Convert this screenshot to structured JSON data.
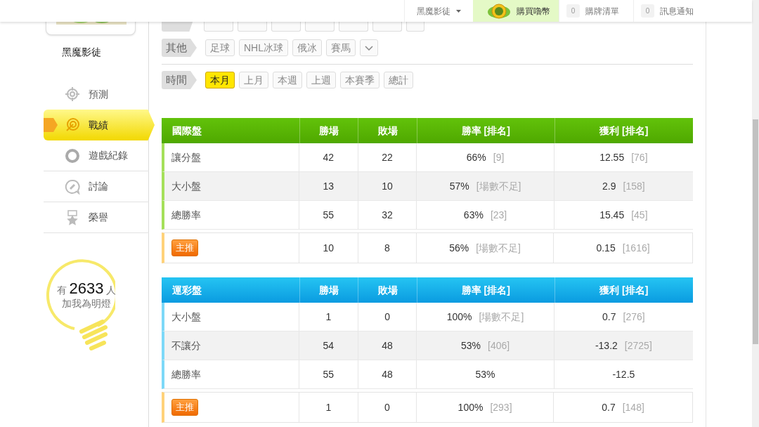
{
  "header": {
    "user_menu": "黑魔影徒",
    "buy_coins": "購買嚕幣",
    "cart": {
      "count": "0",
      "label": "購牌清單"
    },
    "notifications": {
      "count": "0",
      "label": "訊息通知"
    }
  },
  "profile": {
    "name": "黑魔影徒"
  },
  "nav": [
    {
      "label": "預測",
      "selected": false
    },
    {
      "label": "戰績",
      "selected": true
    },
    {
      "label": "遊戲紀錄",
      "selected": false
    },
    {
      "label": "討論",
      "selected": false
    },
    {
      "label": "榮譽",
      "selected": false
    }
  ],
  "fans": {
    "prefix": "有",
    "count": "2633",
    "suffix": "人",
    "caption": "加我為明燈"
  },
  "filters": [
    {
      "label": "其他",
      "options": [
        {
          "label": "足球",
          "selected": false
        },
        {
          "label": "NHL冰球",
          "selected": false
        },
        {
          "label": "俄冰",
          "selected": false
        },
        {
          "label": "賽馬",
          "selected": false
        }
      ],
      "more": true
    },
    {
      "label": "時間",
      "options": [
        {
          "label": "本月",
          "selected": true
        },
        {
          "label": "上月",
          "selected": false
        },
        {
          "label": "本週",
          "selected": false
        },
        {
          "label": "上週",
          "selected": false
        },
        {
          "label": "本賽季",
          "selected": false
        },
        {
          "label": "總計",
          "selected": false
        }
      ],
      "more": false
    }
  ],
  "tables": [
    {
      "kind": "international",
      "columns": [
        "國際盤",
        "勝場",
        "敗場",
        "勝率 [排名]",
        "獲利 [排名]"
      ],
      "rows": [
        {
          "kind": "normal",
          "name": "讓分盤",
          "wins": "42",
          "losses": "22",
          "rate": "66%",
          "rate_rank": "[9]",
          "profit": "12.55",
          "profit_rank": "[76]"
        },
        {
          "kind": "normal",
          "name": "大小盤",
          "wins": "13",
          "losses": "10",
          "rate": "57%",
          "rate_rank": "[場數不足]",
          "profit": "2.9",
          "profit_rank": "[158]"
        },
        {
          "kind": "normal",
          "name": "總勝率",
          "wins": "55",
          "losses": "32",
          "rate": "63%",
          "rate_rank": "[23]",
          "profit": "15.45",
          "profit_rank": "[45]"
        },
        {
          "kind": "featured",
          "name": "主推",
          "wins": "10",
          "losses": "8",
          "rate": "56%",
          "rate_rank": "[場數不足]",
          "profit": "0.15",
          "profit_rank": "[1616]"
        }
      ]
    },
    {
      "kind": "sports_lottery",
      "columns": [
        "運彩盤",
        "勝場",
        "敗場",
        "勝率 [排名]",
        "獲利 [排名]"
      ],
      "rows": [
        {
          "kind": "normal",
          "name": "大小盤",
          "wins": "1",
          "losses": "0",
          "rate": "100%",
          "rate_rank": "[場數不足]",
          "profit": "0.7",
          "profit_rank": "[276]"
        },
        {
          "kind": "normal",
          "name": "不讓分",
          "wins": "54",
          "losses": "48",
          "rate": "53%",
          "rate_rank": "[406]",
          "profit": "-13.2",
          "profit_rank": "[2725]"
        },
        {
          "kind": "normal",
          "name": "總勝率",
          "wins": "55",
          "losses": "48",
          "rate": "53%",
          "profit": "-12.5"
        },
        {
          "kind": "featured",
          "name": "主推",
          "wins": "1",
          "losses": "0",
          "rate": "100%",
          "rate_rank": "[293]",
          "profit": "0.7",
          "profit_rank": "[148]"
        }
      ]
    }
  ]
}
